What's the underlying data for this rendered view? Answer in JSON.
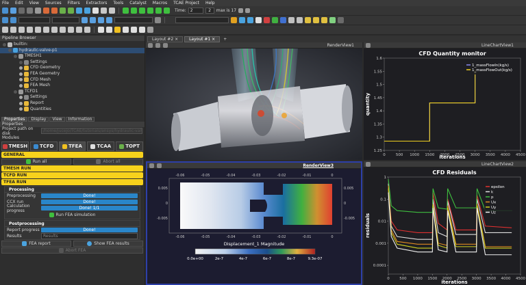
{
  "menu": [
    "File",
    "Edit",
    "View",
    "Sources",
    "Filters",
    "Extractors",
    "Tools",
    "Catalyst",
    "Macros",
    "TCAE Project",
    "Help"
  ],
  "toolbar": {
    "time_label": "Time:",
    "time_value": "2",
    "time_index": "2",
    "max_label": "max is 17"
  },
  "pipeline": {
    "title": "Pipeline Browser",
    "items": [
      {
        "label": "builtin:",
        "depth": 0,
        "icon": "server-icon",
        "color": "#bbbbbb"
      },
      {
        "label": "hydraulic-valve-p1",
        "depth": 1,
        "icon": "project-icon",
        "color": "#4aa3df",
        "selected": true
      },
      {
        "label": "TMESH1",
        "depth": 2,
        "icon": "filter-icon",
        "color": "#9a9a9a"
      },
      {
        "label": "Settings",
        "depth": 3,
        "icon": "settings-icon",
        "color": "#888888"
      },
      {
        "label": "CFD Geometry",
        "depth": 3,
        "icon": "geometry-icon",
        "color": "#e8b83a"
      },
      {
        "label": "FEA Geometry",
        "depth": 3,
        "icon": "geometry-icon",
        "color": "#e8b83a"
      },
      {
        "label": "CFD Mesh",
        "depth": 3,
        "icon": "mesh-icon",
        "color": "#e8b83a"
      },
      {
        "label": "FEA Mesh",
        "depth": 3,
        "icon": "mesh-icon",
        "color": "#e8b83a"
      },
      {
        "label": "TCFD1",
        "depth": 2,
        "icon": "filter-icon",
        "color": "#9a9a9a"
      },
      {
        "label": "Settings",
        "depth": 3,
        "icon": "settings-icon",
        "color": "#888888"
      },
      {
        "label": "Report",
        "depth": 3,
        "icon": "report-icon",
        "color": "#e8b83a"
      },
      {
        "label": "Quantities",
        "depth": 3,
        "icon": "quantities-icon",
        "color": "#e8b83a"
      }
    ]
  },
  "panel_tabs": [
    "Properties",
    "Display",
    "View",
    "Information"
  ],
  "properties": {
    "title": "Properties",
    "path_label": "Project path on disk",
    "path_value": "/home/jucejo/TCAE/tutorials/ansys/hydraulic-valve-p1",
    "modules_label": "Modules",
    "module_tabs": [
      "TMESH",
      "TCFD",
      "TFEA",
      "TCAA",
      "TOPT"
    ],
    "general": "GENERAL",
    "run_all": "Run all",
    "abort_all": "Abort all",
    "tmesh_run": "TMESH RUN",
    "tcfd_run": "TCFD RUN",
    "tfea_run": "TFEA RUN",
    "processing": "Processing",
    "preprocessing_label": "Preprocessing",
    "preprocessing_value": "Done!",
    "ccx_label": "CCX run",
    "ccx_value": "Done!",
    "calc_label": "Calculation progress",
    "calc_value": "Done! 1/1",
    "run_fea": "Run FEA simulation",
    "postprocessing": "Postprocessing",
    "report_label": "Report progress",
    "report_value": "Done!",
    "results_label": "Results",
    "results_value": "Results",
    "fea_report": "FEA report",
    "show_fea": "Show FEA results",
    "abort_fea": "Abort FEA"
  },
  "layout_tabs": [
    "Layout #2",
    "Layout #1"
  ],
  "view_headers": {
    "render1": "RenderView1",
    "chart1": "LineChartView1",
    "render3": "RenderView3",
    "chart2": "LineChartView2"
  },
  "colorbar": {
    "title": "Displacement_1 Magnitude",
    "ticks": [
      "0.0e+00",
      "2e-7",
      "4e-7",
      "6e-7",
      "8e-7",
      "9.3e-07"
    ],
    "axis_top": [
      "-0.06",
      "-0.05",
      "-0.04",
      "-0.03",
      "-0.02",
      "-0.01",
      "0"
    ],
    "axis_bottom": [
      "-0.06",
      "-0.05",
      "-0.04",
      "-0.03",
      "-0.02",
      "-0.01",
      "0"
    ],
    "axis_left": [
      "0.005",
      "0",
      "-0.005"
    ],
    "axis_right": [
      "0.005",
      "0",
      "-0.005"
    ]
  },
  "chart_data": [
    {
      "type": "line",
      "title": "CFD Quantity monitor",
      "xlabel": "iterations",
      "ylabel": "quantity",
      "xlim": [
        0,
        4500
      ],
      "ylim": [
        1.25,
        1.6
      ],
      "xticks": [
        "0",
        "500",
        "1000",
        "1500",
        "2000",
        "2500",
        "3000",
        "3500",
        "4000",
        "4500"
      ],
      "yticks": [
        "1.6",
        "1.55",
        "1.5",
        "1.45",
        "1.4",
        "1.35",
        "1.3",
        "1.25"
      ],
      "series": [
        {
          "name": "1_massFlowIn(kg/s)",
          "color": "#8a8af0",
          "x": [
            0,
            1500,
            1500,
            3000,
            3000
          ],
          "y": [
            1.285,
            1.285,
            1.43,
            1.43,
            1.555
          ]
        },
        {
          "name": "1_massFlowOut(kg/s)",
          "color": "#f0d020",
          "x": [
            0,
            1500,
            1500,
            3000,
            3000
          ],
          "y": [
            1.285,
            1.285,
            1.43,
            1.43,
            1.555
          ]
        }
      ]
    },
    {
      "type": "line",
      "title": "CFD Residuals",
      "xlabel": "iterations",
      "ylabel": "residuals",
      "xlim": [
        0,
        4500
      ],
      "ylim": [
        4e-05,
        1
      ],
      "log_y": true,
      "xticks": [
        "0",
        "500",
        "1000",
        "1500",
        "2000",
        "2500",
        "3000",
        "3500",
        "4000",
        "4500"
      ],
      "yticks": [
        "1",
        "0.1",
        "0.01",
        "0.001",
        "0.0001"
      ],
      "series": [
        {
          "name": "epsilon",
          "color": "#e03030",
          "x": [
            0,
            100,
            300,
            1000,
            1500,
            1520,
            1700,
            2000,
            2020,
            2300,
            3000,
            3020,
            3300,
            4200
          ],
          "y": [
            0.3,
            0.01,
            0.004,
            0.003,
            0.003,
            0.2,
            0.008,
            0.004,
            0.1,
            0.004,
            0.004,
            0.15,
            0.006,
            0.005
          ]
        },
        {
          "name": "k",
          "color": "#e0e0e0",
          "x": [
            0,
            100,
            300,
            1000,
            1500,
            1520,
            1700,
            2000,
            2020,
            2300,
            3000,
            3020,
            3300,
            4200
          ],
          "y": [
            0.5,
            0.006,
            0.002,
            0.0015,
            0.0015,
            0.1,
            0.003,
            0.002,
            0.08,
            0.0025,
            0.0025,
            0.1,
            0.003,
            0.003
          ]
        },
        {
          "name": "p",
          "color": "#3fbf3f",
          "x": [
            0,
            100,
            300,
            1000,
            1500,
            1520,
            1700,
            2000,
            2020,
            2300,
            3000,
            3020,
            3300,
            4200
          ],
          "y": [
            0.8,
            0.05,
            0.03,
            0.025,
            0.025,
            0.3,
            0.04,
            0.035,
            0.3,
            0.04,
            0.04,
            0.3,
            0.03,
            0.03
          ]
        },
        {
          "name": "Ux",
          "color": "#e08a20",
          "x": [
            0,
            100,
            300,
            1000,
            1500,
            1520,
            1700,
            2000,
            2020,
            2300,
            3000,
            3020,
            3300,
            4200
          ],
          "y": [
            0.4,
            0.004,
            0.0012,
            0.0009,
            0.0009,
            0.06,
            0.001,
            0.0008,
            0.05,
            0.0009,
            0.0009,
            0.06,
            0.0007,
            0.0007
          ]
        },
        {
          "name": "Uy",
          "color": "#d0d020",
          "x": [
            0,
            100,
            300,
            1000,
            1500,
            1520,
            1700,
            2000,
            2020,
            2300,
            3000,
            3020,
            3300,
            4200
          ],
          "y": [
            0.3,
            0.003,
            0.0009,
            0.0006,
            0.0006,
            0.05,
            0.0008,
            0.0006,
            0.04,
            0.0007,
            0.0007,
            0.05,
            0.0006,
            0.0006
          ]
        },
        {
          "name": "Uz",
          "color": "#f2f2f2",
          "x": [
            0,
            100,
            300,
            1000,
            1500,
            1520,
            1700,
            2000,
            2020,
            2300,
            3000,
            3020,
            3300,
            4200
          ],
          "y": [
            0.2,
            0.002,
            0.0006,
            0.0004,
            0.0004,
            0.04,
            0.0005,
            0.0004,
            0.03,
            0.0004,
            0.0004,
            0.04,
            0.0003,
            0.0003
          ]
        }
      ]
    }
  ]
}
